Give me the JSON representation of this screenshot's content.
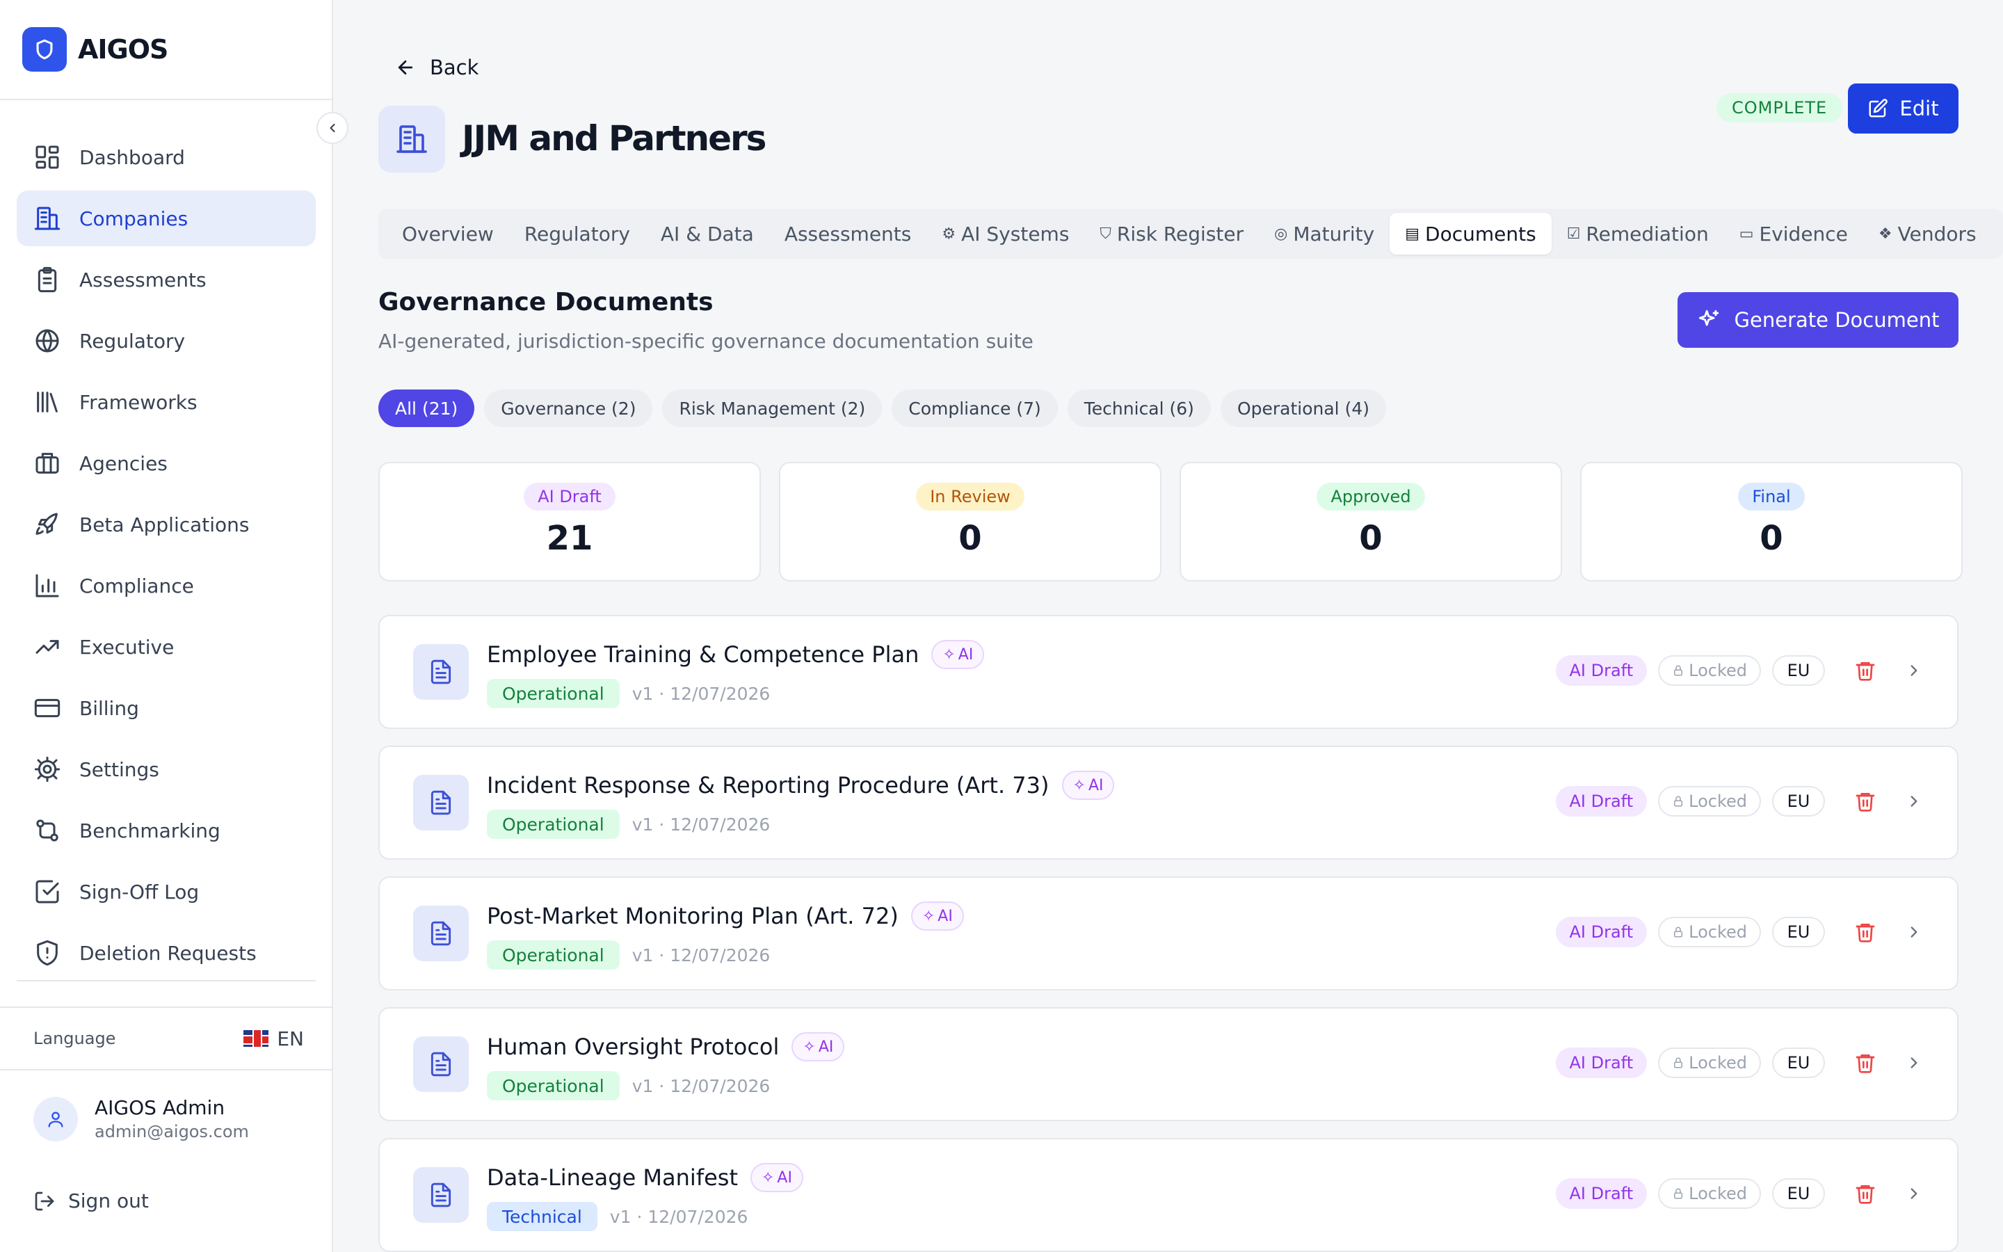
{
  "app": {
    "name": "AIGOS"
  },
  "sidebar": {
    "items": [
      {
        "label": "Dashboard",
        "icon": "dashboard-icon"
      },
      {
        "label": "Companies",
        "icon": "building-icon",
        "active": true
      },
      {
        "label": "Assessments",
        "icon": "clipboard-icon"
      },
      {
        "label": "Regulatory",
        "icon": "globe-icon"
      },
      {
        "label": "Frameworks",
        "icon": "library-icon"
      },
      {
        "label": "Agencies",
        "icon": "briefcase-icon"
      },
      {
        "label": "Beta Applications",
        "icon": "rocket-icon"
      },
      {
        "label": "Compliance",
        "icon": "bar-chart-icon"
      },
      {
        "label": "Executive",
        "icon": "trending-up-icon"
      },
      {
        "label": "Billing",
        "icon": "credit-card-icon"
      },
      {
        "label": "Settings",
        "icon": "gear-icon"
      },
      {
        "label": "Benchmarking",
        "icon": "git-compare-icon"
      },
      {
        "label": "Sign-Off Log",
        "icon": "check-square-icon"
      },
      {
        "label": "Deletion Requests",
        "icon": "shield-alert-icon"
      }
    ],
    "language_label": "Language",
    "language_value": "EN",
    "user": {
      "name": "AIGOS Admin",
      "email": "admin@aigos.com"
    },
    "sign_out": "Sign out"
  },
  "header": {
    "back_label": "Back",
    "company_name": "JJM and Partners",
    "status_badge": "COMPLETE",
    "edit_label": "Edit"
  },
  "tabs": [
    {
      "label": "Overview",
      "icon": ""
    },
    {
      "label": "Regulatory",
      "icon": ""
    },
    {
      "label": "AI & Data",
      "icon": ""
    },
    {
      "label": "Assessments",
      "icon": ""
    },
    {
      "label": "AI Systems",
      "icon": "cpu-icon"
    },
    {
      "label": "Risk Register",
      "icon": "shield-icon"
    },
    {
      "label": "Maturity",
      "icon": "target-icon"
    },
    {
      "label": "Documents",
      "icon": "file-icon",
      "active": true
    },
    {
      "label": "Remediation",
      "icon": "list-checks-icon"
    },
    {
      "label": "Evidence",
      "icon": "archive-icon"
    },
    {
      "label": "Vendors",
      "icon": "boxes-icon"
    }
  ],
  "section": {
    "title": "Governance Documents",
    "subtitle": "AI-generated, jurisdiction-specific governance documentation suite",
    "generate_label": "Generate Document"
  },
  "filters": [
    {
      "label": "All (21)",
      "active": true
    },
    {
      "label": "Governance (2)"
    },
    {
      "label": "Risk Management (2)"
    },
    {
      "label": "Compliance (7)"
    },
    {
      "label": "Technical (6)"
    },
    {
      "label": "Operational (4)"
    }
  ],
  "stats": [
    {
      "label": "AI Draft",
      "value": "21",
      "bg": "#f3e8ff",
      "fg": "#9333ea"
    },
    {
      "label": "In Review",
      "value": "0",
      "bg": "#fef3c7",
      "fg": "#b45309"
    },
    {
      "label": "Approved",
      "value": "0",
      "bg": "#dcfce7",
      "fg": "#15803d"
    },
    {
      "label": "Final",
      "value": "0",
      "bg": "#dbeafe",
      "fg": "#1d4ed8"
    }
  ],
  "documents": [
    {
      "title": "Employee Training & Competence Plan",
      "ai": "AI",
      "category": "Operational",
      "version": "v1 · 12/07/2026",
      "status": "AI Draft",
      "locked": "Locked",
      "jurisdiction": "EU"
    },
    {
      "title": "Incident Response & Reporting Procedure (Art. 73)",
      "ai": "AI",
      "category": "Operational",
      "version": "v1 · 12/07/2026",
      "status": "AI Draft",
      "locked": "Locked",
      "jurisdiction": "EU"
    },
    {
      "title": "Post-Market Monitoring Plan (Art. 72)",
      "ai": "AI",
      "category": "Operational",
      "version": "v1 · 12/07/2026",
      "status": "AI Draft",
      "locked": "Locked",
      "jurisdiction": "EU"
    },
    {
      "title": "Human Oversight Protocol",
      "ai": "AI",
      "category": "Operational",
      "version": "v1 · 12/07/2026",
      "status": "AI Draft",
      "locked": "Locked",
      "jurisdiction": "EU"
    },
    {
      "title": "Data-Lineage Manifest",
      "ai": "AI",
      "category": "Technical",
      "version": "v1 · 12/07/2026",
      "status": "AI Draft",
      "locked": "Locked",
      "jurisdiction": "EU"
    }
  ],
  "colors": {
    "primary": "#1d3fe0",
    "accent": "#4f46e5",
    "danger": "#ef4444"
  }
}
